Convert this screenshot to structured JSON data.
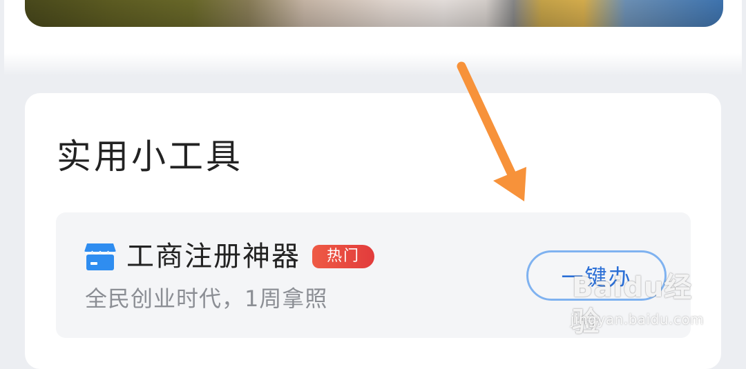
{
  "section": {
    "title": "实用小工具"
  },
  "tool": {
    "icon": "store-icon",
    "name": "工商注册神器",
    "badge": "热门",
    "description": "全民创业时代，1周拿照",
    "action_label": "一键办"
  },
  "watermark": {
    "logo": "Baidu经验",
    "url": "jingyan.baidu.com"
  },
  "colors": {
    "accent_blue": "#2b6fd6",
    "badge_red": "#e5473f",
    "arrow_orange": "#f7923a",
    "icon_blue": "#2f8df0"
  }
}
